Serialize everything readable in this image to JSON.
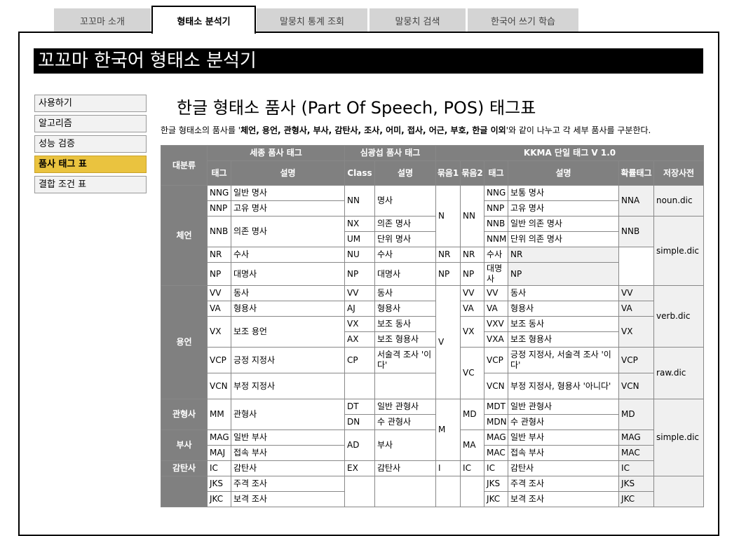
{
  "tabs": [
    "꼬꼬마 소개",
    "형태소 분석기",
    "말뭉치 통계 조회",
    "말뭉치 검색",
    "한국어 쓰기 학습"
  ],
  "page_title": "꼬꼬마 한국어 형태소 분석기",
  "sidebar": [
    "사용하기",
    "알고리즘",
    "성능 검증",
    "품사 태그 표",
    "결합 조건 표"
  ],
  "content": {
    "title": "한글 형태소 품사 (Part Of Speech, POS) 태그표",
    "intro_prefix": "한글 형태소의 품사를 '",
    "intro_bold": "체언, 용언, 관형사, 부사, 감탄사, 조사, 어미, 접사, 어근, 부호, 한글 이외",
    "intro_suffix": "'와 같이 나누고 각 세부 품사를 구분한다."
  },
  "table": {
    "h_major": "대분류",
    "h_sejong": "세종 품사 태그",
    "h_simkwang": "심광섭 품사 태그",
    "h_kkma": "KKMA 단일 태그 V 1.0",
    "h_tag": "태그",
    "h_desc": "설명",
    "h_class": "Class",
    "h_group1": "묶음1",
    "h_group2": "묶음2",
    "h_prob": "확률태그",
    "h_dict": "저장사전",
    "cat": {
      "che": "체언",
      "yong": "용언",
      "gwan": "관형사",
      "bu": "부사",
      "gam": "감탄사"
    },
    "sj": [
      [
        "NNG",
        "일반 명사"
      ],
      [
        "NNP",
        "고유 명사"
      ],
      [
        "NNB",
        "의존 명사"
      ],
      [
        "NR",
        "수사"
      ],
      [
        "NP",
        "대명사"
      ],
      [
        "VV",
        "동사"
      ],
      [
        "VA",
        "형용사"
      ],
      [
        "VX",
        "보조 용언"
      ],
      [
        "VCP",
        "긍정 지정사"
      ],
      [
        "VCN",
        "부정 지정사"
      ],
      [
        "MM",
        "관형사"
      ],
      [
        "MAG",
        "일반 부사"
      ],
      [
        "MAJ",
        "접속 부사"
      ],
      [
        "IC",
        "감탄사"
      ],
      [
        "JKS",
        "주격 조사"
      ],
      [
        "JKC",
        "보격 조사"
      ]
    ],
    "sk": [
      [
        "NN",
        "명사"
      ],
      [
        "NX",
        "의존 명사"
      ],
      [
        "UM",
        "단위 명사"
      ],
      [
        "NU",
        "수사"
      ],
      [
        "NP",
        "대명사"
      ],
      [
        "VV",
        "동사"
      ],
      [
        "AJ",
        "형용사"
      ],
      [
        "VX",
        "보조 동사"
      ],
      [
        "AX",
        "보조 형용사"
      ],
      [
        "CP",
        "서술격 조사 '이다'"
      ],
      [
        "DT",
        "일반 관형사"
      ],
      [
        "DN",
        "수 관형사"
      ],
      [
        "AD",
        "부사"
      ],
      [
        "EX",
        "감탄사"
      ]
    ],
    "g1": [
      "N",
      "V",
      "M",
      "I"
    ],
    "g2": [
      "NN",
      "NR",
      "NP",
      "VV",
      "VA",
      "VX",
      "VC",
      "MD",
      "MA",
      "IC"
    ],
    "kk": [
      [
        "NNG",
        "보통 명사"
      ],
      [
        "NNP",
        "고유 명사"
      ],
      [
        "NNB",
        "일반 의존 명사"
      ],
      [
        "NNM",
        "단위 의존 명사"
      ],
      [
        "NR",
        "수사"
      ],
      [
        "NP",
        "대명사"
      ],
      [
        "VV",
        "동사"
      ],
      [
        "VA",
        "형용사"
      ],
      [
        "VXV",
        "보조 동사"
      ],
      [
        "VXA",
        "보조 형용사"
      ],
      [
        "VCP",
        "긍정 지정사, 서술격 조사 '이다'"
      ],
      [
        "VCN",
        "부정 지정사, 형용사 '아니다'"
      ],
      [
        "MDT",
        "일반 관형사"
      ],
      [
        "MDN",
        "수 관형사"
      ],
      [
        "MAG",
        "일반 부사"
      ],
      [
        "MAC",
        "접속 부사"
      ],
      [
        "IC",
        "감탄사"
      ],
      [
        "JKS",
        "주격 조사"
      ],
      [
        "JKC",
        "보격 조사"
      ]
    ],
    "prob": [
      "NNA",
      "NNB",
      "NR",
      "NP",
      "VV",
      "VA",
      "VX",
      "VCP",
      "VCN",
      "MD",
      "MAG",
      "MAC",
      "IC",
      "JKS",
      "JKC"
    ],
    "dict": [
      "noun.dic",
      "simple.dic",
      "verb.dic",
      "raw.dic",
      "simple.dic"
    ]
  }
}
